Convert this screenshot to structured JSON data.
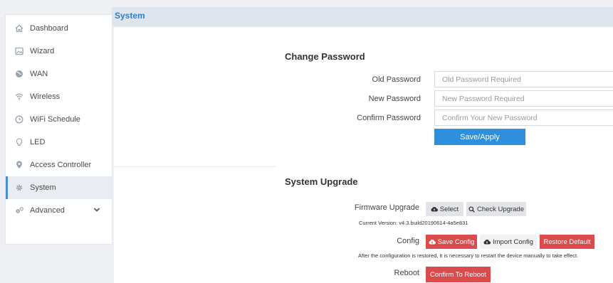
{
  "header": {
    "title": "System"
  },
  "sidebar": {
    "items": [
      {
        "label": "Dashboard",
        "icon": "home-icon"
      },
      {
        "label": "Wizard",
        "icon": "image-icon"
      },
      {
        "label": "WAN",
        "icon": "globe-icon"
      },
      {
        "label": "Wireless",
        "icon": "wifi-icon"
      },
      {
        "label": "WiFi Schedule",
        "icon": "clock-icon"
      },
      {
        "label": "LED",
        "icon": "bulb-icon"
      },
      {
        "label": "Access Controller",
        "icon": "pin-icon"
      },
      {
        "label": "System",
        "icon": "gear-icon",
        "active": true
      },
      {
        "label": "Advanced",
        "icon": "gears-icon"
      }
    ]
  },
  "password": {
    "title": "Change Password",
    "old_label": "Old Password",
    "old_placeholder": "Old Password Required",
    "new_label": "New Password",
    "new_placeholder": "New Password Required",
    "confirm_label": "Confirm Password",
    "confirm_placeholder": "Confirm Your New Password",
    "save_label": "Save/Apply"
  },
  "upgrade": {
    "title": "System Upgrade",
    "firmware_label": "Firmware Upgrade",
    "select_label": "Select",
    "check_label": "Check Upgrade",
    "current_version": "Current Version: v4.3.build20190614-4a5e831",
    "config_label": "Config",
    "save_config_label": "Save Config",
    "import_config_label": "Import Config",
    "restore_label": "Restore Default",
    "config_note": "After the configuration is restored, it is necessary to restart the device manually to take effect.",
    "reboot_label": "Reboot",
    "reboot_button": "Confirm To Reboot"
  },
  "colors": {
    "accent": "#2e8fdc",
    "danger": "#dc4b4b",
    "title": "#2d7fc7"
  }
}
